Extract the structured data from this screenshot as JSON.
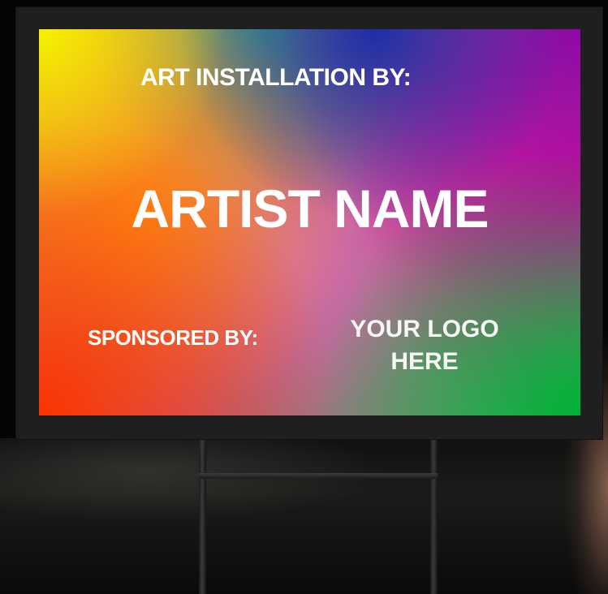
{
  "sign": {
    "heading": "ART INSTALLATION BY:",
    "artist_name": "ARTIST NAME",
    "sponsored_label": "SPONSORED BY:",
    "logo_line1": "YOUR LOGO",
    "logo_line2": "HERE"
  },
  "colors": {
    "frame": "#1f1f1f",
    "text": "#ffffff",
    "gradient_corners": [
      "#f4f200",
      "#8d08a6",
      "#fb3400",
      "#00b237"
    ],
    "gradient_mid": [
      "#1c2ea8",
      "#f0069a",
      "#ff8f12",
      "#d06db0"
    ]
  }
}
